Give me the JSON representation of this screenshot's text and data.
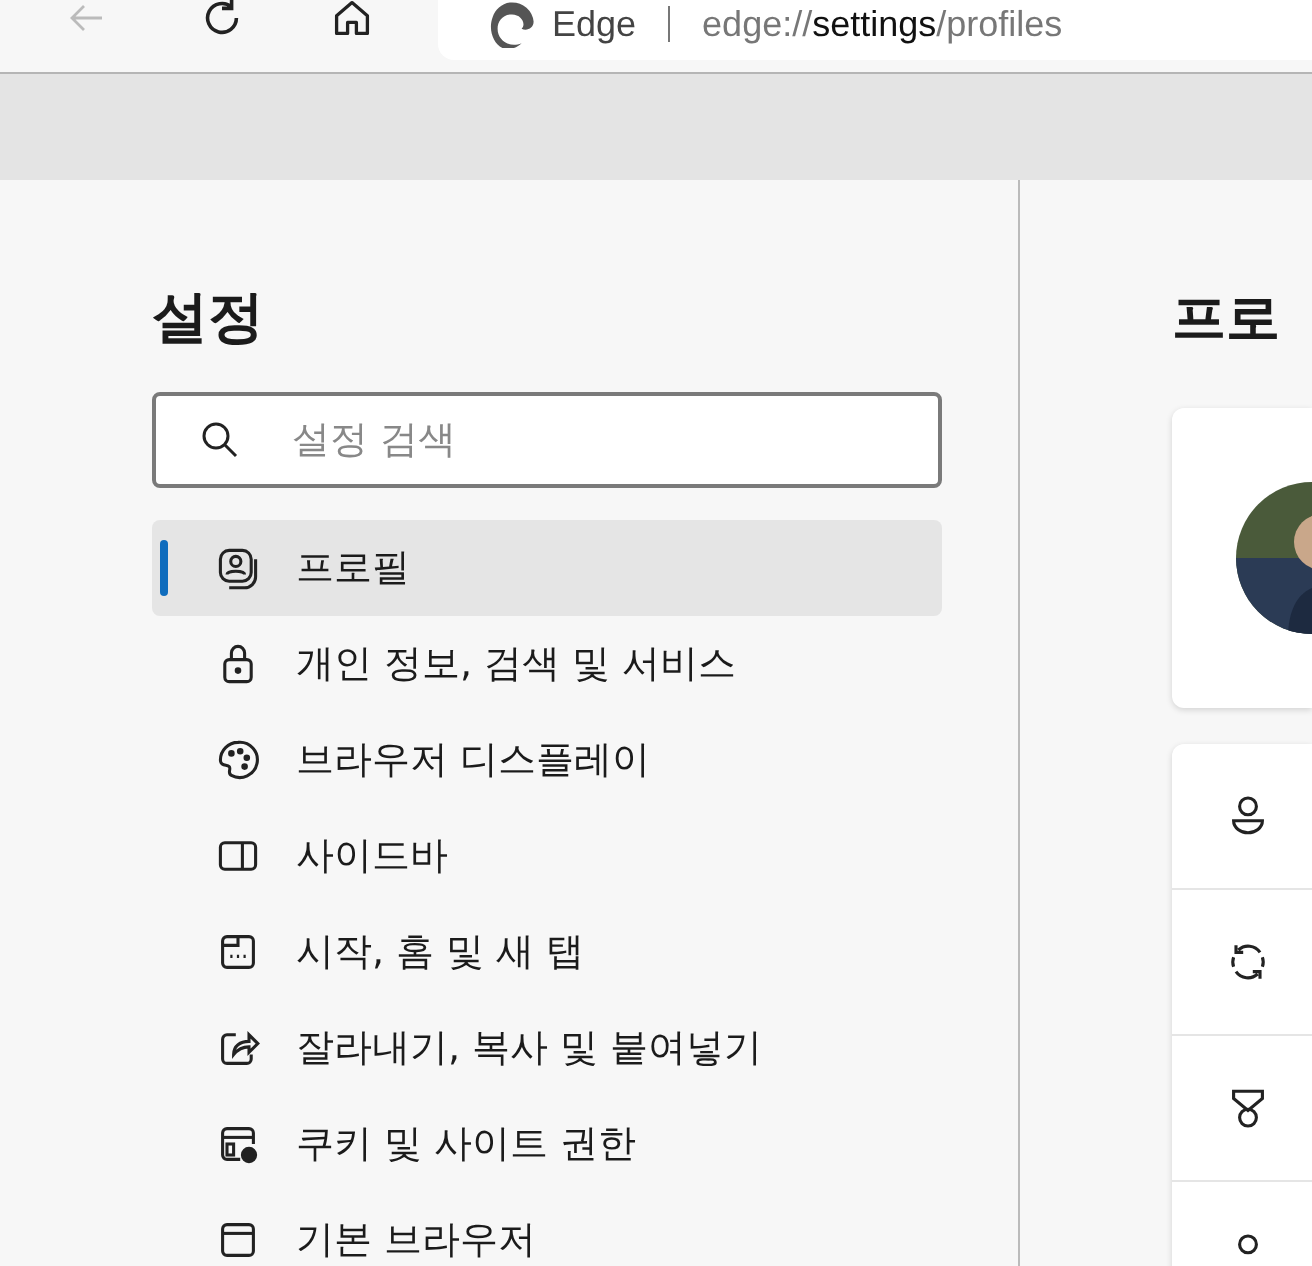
{
  "toolbar": {
    "browser_name": "Edge",
    "url": {
      "scheme": "edge://",
      "host": "settings",
      "path": "/profiles"
    }
  },
  "sidebar": {
    "title": "설정",
    "search": {
      "placeholder": "설정 검색"
    },
    "items": [
      {
        "label": "프로필",
        "selected": true
      },
      {
        "label": "개인 정보, 검색 및 서비스",
        "selected": false
      },
      {
        "label": "브라우저 디스플레이",
        "selected": false
      },
      {
        "label": "사이드바",
        "selected": false
      },
      {
        "label": "시작, 홈 및 새 탭",
        "selected": false
      },
      {
        "label": "잘라내기, 복사 및 붙여넣기",
        "selected": false
      },
      {
        "label": "쿠키 및 사이트 권한",
        "selected": false
      },
      {
        "label": "기본 브라우저",
        "selected": false
      }
    ]
  },
  "main": {
    "title": "프로"
  }
}
